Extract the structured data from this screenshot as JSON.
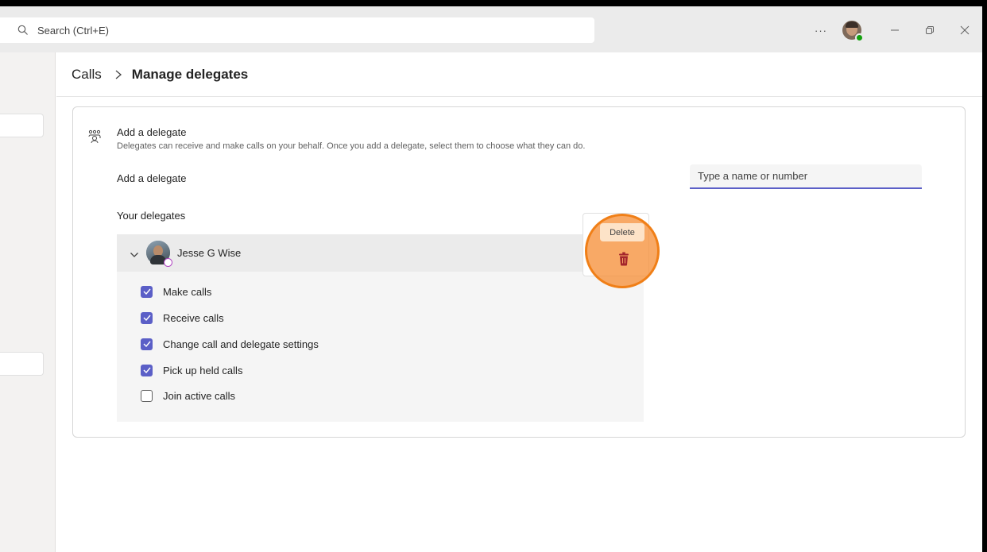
{
  "titlebar": {
    "search_placeholder": "Search (Ctrl+E)",
    "more_label": "···"
  },
  "header": {
    "crumb_parent": "Calls",
    "crumb_current": "Manage delegates"
  },
  "card": {
    "title": "Add a delegate",
    "description": "Delegates can receive and make calls on your behalf. Once you add a delegate, select them to choose what they can do.",
    "add_label": "Add a delegate",
    "input_placeholder": "Type a name or number",
    "delegates_label": "Your delegates"
  },
  "delegate": {
    "name": "Jesse G Wise",
    "delete_tooltip": "Delete",
    "permissions": [
      {
        "label": "Make calls",
        "checked": true
      },
      {
        "label": "Receive calls",
        "checked": true
      },
      {
        "label": "Change call and delegate settings",
        "checked": true
      },
      {
        "label": "Pick up held calls",
        "checked": true
      },
      {
        "label": "Join active calls",
        "checked": false
      }
    ]
  },
  "colors": {
    "accent": "#5b5fc7",
    "highlight": "#f07f17",
    "trash": "#a4262c"
  }
}
